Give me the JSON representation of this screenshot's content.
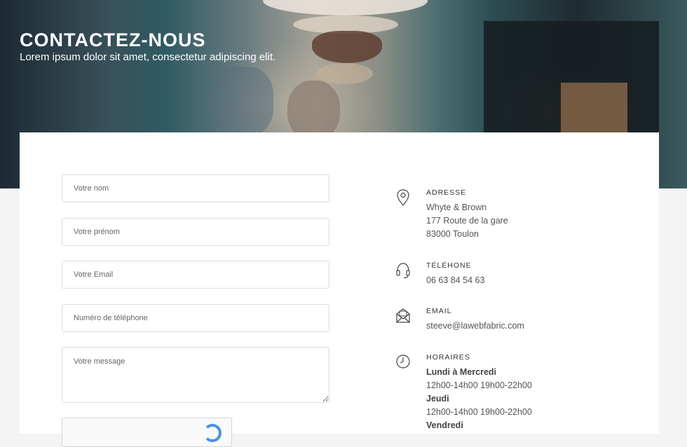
{
  "hero": {
    "title": "CONTACTEZ-NOUS",
    "subtitle": "Lorem ipsum dolor sit amet, consectetur adipiscing elit."
  },
  "form": {
    "name_placeholder": "Votre nom",
    "firstname_placeholder": "Votre prénom",
    "email_placeholder": "Votre Email",
    "phone_placeholder": "Numéro de téléphone",
    "message_placeholder": "Votre message"
  },
  "contact": {
    "address": {
      "icon": "map-pin-icon",
      "label": "ADRESSE",
      "lines": [
        "Whyte & Brown",
        "177 Route de la gare",
        "83000 Toulon"
      ]
    },
    "phone": {
      "icon": "headset-icon",
      "label": "TÉLÉHONE",
      "value": "06 63 84 54 63"
    },
    "email": {
      "icon": "envelope-icon",
      "label": "EMAIL",
      "value": "steeve@lawebfabric.com"
    },
    "hours": {
      "icon": "clock-icon",
      "label": "HORAIRES",
      "lines": [
        {
          "text": "Lundi à Mercredi",
          "bold": true
        },
        {
          "text": "12h00-14h00 19h00-22h00",
          "bold": false
        },
        {
          "text": "Jeudi",
          "bold": true
        },
        {
          "text": "12h00-14h00 19h00-22h00",
          "bold": false
        },
        {
          "text": "Vendredi",
          "bold": true
        }
      ]
    }
  },
  "colors": {
    "accent": "#4a90e2",
    "text": "#555555"
  }
}
